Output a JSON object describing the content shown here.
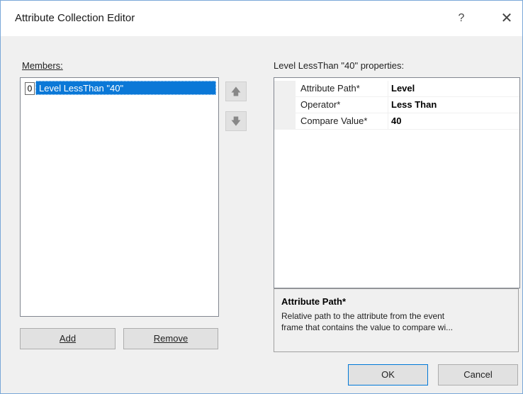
{
  "window": {
    "title": "Attribute Collection Editor",
    "help_glyph": "?",
    "close_glyph": "✕"
  },
  "members": {
    "label": "Members:",
    "items": [
      {
        "index": "0",
        "label": "Level LessThan \"40\""
      }
    ],
    "move_up_glyph": "🡅",
    "move_down_glyph": "🡇",
    "add_label": "Add",
    "remove_label": "Remove"
  },
  "properties": {
    "header": "Level LessThan \"40\" properties:",
    "rows": [
      {
        "name": "Attribute Path*",
        "value": "Level"
      },
      {
        "name": "Operator*",
        "value": "Less Than"
      },
      {
        "name": "Compare Value*",
        "value": "40"
      }
    ],
    "description_title": "Attribute Path*",
    "description_text": "Relative path to the attribute from the event\nframe that contains the value to compare wi..."
  },
  "footer": {
    "ok_label": "OK",
    "cancel_label": "Cancel"
  },
  "colors": {
    "selection": "#0b78d7",
    "window_border": "#7aa8d8",
    "ok_border": "#0078d7"
  }
}
